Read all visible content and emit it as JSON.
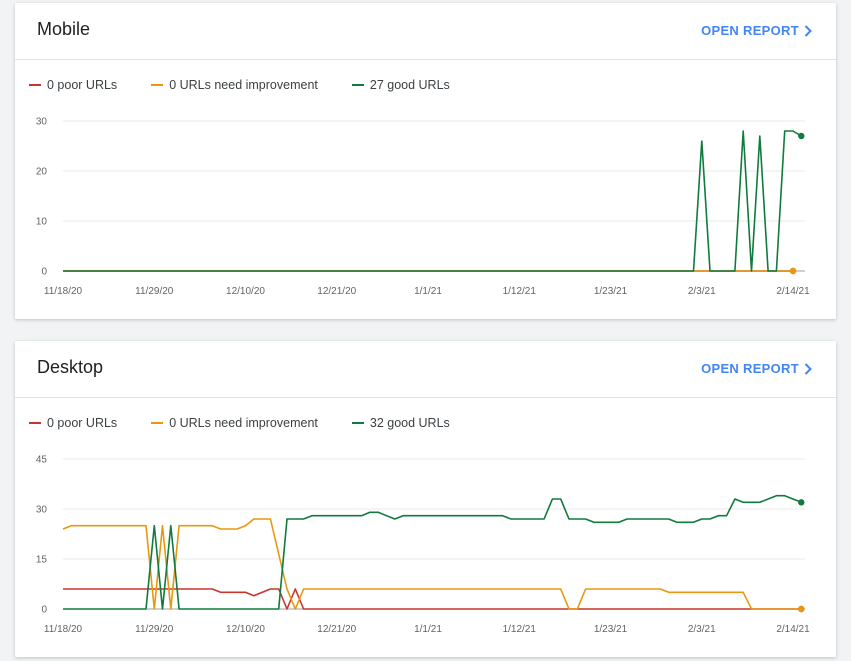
{
  "cards": [
    {
      "title": "Mobile",
      "open_report_label": "OPEN REPORT",
      "legend": {
        "poor": "0 poor URLs",
        "needs": "0 URLs need improvement",
        "good": "27 good URLs"
      }
    },
    {
      "title": "Desktop",
      "open_report_label": "OPEN REPORT",
      "legend": {
        "poor": "0 poor URLs",
        "needs": "0 URLs need improvement",
        "good": "32 good URLs"
      }
    }
  ],
  "colors": {
    "poor": "#c5372c",
    "needs": "#e8980f",
    "good": "#117a3d",
    "link": "#4285f4",
    "grid": "#e8e8e8"
  },
  "chart_data": [
    {
      "type": "line",
      "x_start": "11/18/20",
      "x_end": "2/14/21",
      "xticks": [
        "11/18/20",
        "11/29/20",
        "12/10/20",
        "12/21/20",
        "1/1/21",
        "1/12/21",
        "1/23/21",
        "2/3/21",
        "2/14/21"
      ],
      "ylim": [
        0,
        30
      ],
      "yticks": [
        0,
        10,
        20,
        30
      ],
      "grid": true,
      "legend_position": "top-left",
      "series": [
        {
          "name": "0 poor URLs",
          "key": "poor",
          "points": [
            [
              "11/18/20",
              0
            ],
            [
              "2/14/21",
              0
            ]
          ]
        },
        {
          "name": "0 URLs need improvement",
          "key": "needs",
          "points": [
            [
              "11/18/20",
              0
            ],
            [
              "2/14/21",
              0
            ]
          ]
        },
        {
          "name": "27 good URLs",
          "key": "good",
          "points": [
            [
              "11/18/20",
              0
            ],
            [
              "2/2/21",
              0
            ],
            [
              "2/3/21",
              26
            ],
            [
              "2/4/21",
              0
            ],
            [
              "2/7/21",
              0
            ],
            [
              "2/8/21",
              28
            ],
            [
              "2/9/21",
              0
            ],
            [
              "2/10/21",
              27
            ],
            [
              "2/11/21",
              0
            ],
            [
              "2/12/21",
              0
            ],
            [
              "2/13/21",
              28
            ],
            [
              "2/14/21",
              28
            ],
            [
              "2/15/21",
              27
            ]
          ]
        }
      ]
    },
    {
      "type": "line",
      "x_start": "11/18/20",
      "x_end": "2/14/21",
      "xticks": [
        "11/18/20",
        "11/29/20",
        "12/10/20",
        "12/21/20",
        "1/1/21",
        "1/12/21",
        "1/23/21",
        "2/3/21",
        "2/14/21"
      ],
      "ylim": [
        0,
        45
      ],
      "yticks": [
        0,
        15,
        30,
        45
      ],
      "grid": true,
      "legend_position": "top-left",
      "series": [
        {
          "name": "0 poor URLs",
          "key": "poor",
          "points": [
            [
              "11/18/20",
              6
            ],
            [
              "12/6/20",
              6
            ],
            [
              "12/7/20",
              5
            ],
            [
              "12/10/20",
              5
            ],
            [
              "12/11/20",
              4
            ],
            [
              "12/13/20",
              6
            ],
            [
              "12/14/20",
              6
            ],
            [
              "12/15/20",
              0
            ],
            [
              "12/16/20",
              6
            ],
            [
              "12/17/20",
              0
            ],
            [
              "2/15/21",
              0
            ]
          ]
        },
        {
          "name": "0 URLs need improvement",
          "key": "needs",
          "points": [
            [
              "11/18/20",
              24
            ],
            [
              "11/19/20",
              25
            ],
            [
              "11/28/20",
              25
            ],
            [
              "11/29/20",
              0
            ],
            [
              "11/30/20",
              25
            ],
            [
              "12/1/20",
              0
            ],
            [
              "12/2/20",
              25
            ],
            [
              "12/6/20",
              25
            ],
            [
              "12/7/20",
              24
            ],
            [
              "12/9/20",
              24
            ],
            [
              "12/10/20",
              25
            ],
            [
              "12/11/20",
              27
            ],
            [
              "12/13/20",
              27
            ],
            [
              "12/15/20",
              6
            ],
            [
              "12/16/20",
              0
            ],
            [
              "12/17/20",
              6
            ],
            [
              "1/17/21",
              6
            ],
            [
              "1/18/21",
              0
            ],
            [
              "1/19/21",
              0
            ],
            [
              "1/20/21",
              6
            ],
            [
              "1/29/21",
              6
            ],
            [
              "1/30/21",
              5
            ],
            [
              "2/8/21",
              5
            ],
            [
              "2/9/21",
              0
            ],
            [
              "2/15/21",
              0
            ]
          ]
        },
        {
          "name": "32 good URLs",
          "key": "good",
          "points": [
            [
              "11/18/20",
              0
            ],
            [
              "11/28/20",
              0
            ],
            [
              "11/29/20",
              25
            ],
            [
              "11/30/20",
              0
            ],
            [
              "12/1/20",
              25
            ],
            [
              "12/2/20",
              0
            ],
            [
              "12/14/20",
              0
            ],
            [
              "12/15/20",
              27
            ],
            [
              "12/17/20",
              27
            ],
            [
              "12/18/20",
              28
            ],
            [
              "12/24/20",
              28
            ],
            [
              "12/25/20",
              29
            ],
            [
              "12/26/20",
              29
            ],
            [
              "12/28/20",
              27
            ],
            [
              "12/29/20",
              28
            ],
            [
              "1/10/21",
              28
            ],
            [
              "1/11/21",
              27
            ],
            [
              "1/15/21",
              27
            ],
            [
              "1/16/21",
              33
            ],
            [
              "1/17/21",
              33
            ],
            [
              "1/18/21",
              27
            ],
            [
              "1/20/21",
              27
            ],
            [
              "1/21/21",
              26
            ],
            [
              "1/24/21",
              26
            ],
            [
              "1/25/21",
              27
            ],
            [
              "1/30/21",
              27
            ],
            [
              "1/31/21",
              26
            ],
            [
              "2/2/21",
              26
            ],
            [
              "2/3/21",
              27
            ],
            [
              "2/4/21",
              27
            ],
            [
              "2/5/21",
              28
            ],
            [
              "2/6/21",
              28
            ],
            [
              "2/7/21",
              33
            ],
            [
              "2/8/21",
              32
            ],
            [
              "2/10/21",
              32
            ],
            [
              "2/12/21",
              34
            ],
            [
              "2/13/21",
              34
            ],
            [
              "2/14/21",
              33
            ],
            [
              "2/15/21",
              32
            ]
          ]
        }
      ]
    }
  ]
}
